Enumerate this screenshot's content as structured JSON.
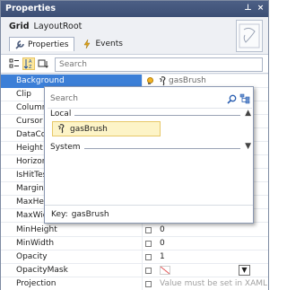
{
  "window": {
    "title": "Properties",
    "pin_glyph": "⊥",
    "close_glyph": "×"
  },
  "header": {
    "type_name": "Grid",
    "element_name": "LayoutRoot",
    "tabs": [
      {
        "label": "Properties",
        "icon": "wrench-icon",
        "active": true
      },
      {
        "label": "Events",
        "icon": "lightning-icon",
        "active": false
      }
    ]
  },
  "toolbar": {
    "search_placeholder": "Search",
    "buttons": [
      {
        "name": "categorize-button",
        "icon": "categorize-icon",
        "active": false
      },
      {
        "name": "sort-az-button",
        "icon": "sort-alpha-icon",
        "active": true
      },
      {
        "name": "sort-source-button",
        "icon": "sort-source-icon",
        "active": false
      }
    ]
  },
  "properties": [
    {
      "name": "Background",
      "value": "gasBrush",
      "selected": true
    },
    {
      "name": "Clip",
      "value": ""
    },
    {
      "name": "Columns",
      "value": ""
    },
    {
      "name": "Cursor",
      "value": ""
    },
    {
      "name": "DataContext",
      "value": ""
    },
    {
      "name": "Height",
      "value": ""
    },
    {
      "name": "HorizontalAlignment",
      "value": ""
    },
    {
      "name": "IsHitTestVisible",
      "value": ""
    },
    {
      "name": "Margin",
      "value": ""
    },
    {
      "name": "MaxHeight",
      "value": ""
    },
    {
      "name": "MaxWidth",
      "value": ""
    },
    {
      "name": "MinHeight",
      "value": "0"
    },
    {
      "name": "MinWidth",
      "value": "0"
    },
    {
      "name": "Opacity",
      "value": "1"
    },
    {
      "name": "OpacityMask",
      "value": ""
    },
    {
      "name": "Projection",
      "value": "Value must be set in XAML"
    }
  ],
  "resource_picker": {
    "search_placeholder": "Search",
    "sections": [
      {
        "label": "Local",
        "expanded": true,
        "chevron": "▲"
      },
      {
        "label": "System",
        "expanded": false,
        "chevron": "▼"
      }
    ],
    "selected_item": "gasBrush",
    "footer_key_label": "Key:",
    "footer_key_value": "gasBrush"
  },
  "colors": {
    "titlebar": "#42557b",
    "selection_blue": "#3c7fd7",
    "highlight_yellow": "#fdf4c7"
  }
}
